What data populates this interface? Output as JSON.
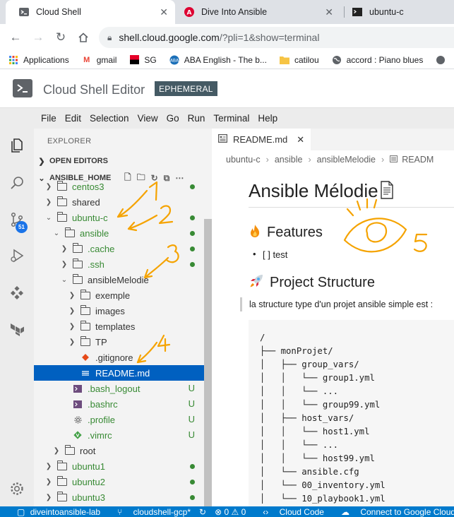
{
  "browser": {
    "tabs": [
      {
        "title": "Cloud Shell",
        "active": true
      },
      {
        "title": "Dive Into Ansible",
        "active": false
      },
      {
        "title": "ubuntu-c",
        "active": false
      }
    ],
    "url_host": "shell.cloud.google.com",
    "url_path": "/?pli=1&show=terminal",
    "bookmarks": [
      "Applications",
      "gmail",
      "SG",
      "ABA English - The b...",
      "catilou",
      "accord : Piano blues"
    ]
  },
  "cloudshell": {
    "title": "Cloud Shell Editor",
    "badge": "EPHEMERAL"
  },
  "menu": [
    "File",
    "Edit",
    "Selection",
    "View",
    "Go",
    "Run",
    "Terminal",
    "Help"
  ],
  "activity": {
    "scm_badge": "51"
  },
  "explorer": {
    "header": "EXPLORER",
    "open_editors": "OPEN EDITORS",
    "workspace": "ANSIBLE_HOME",
    "items": [
      {
        "label": "centos3",
        "indent": 1,
        "kind": "folder",
        "open": false,
        "green": true,
        "mark": "dot"
      },
      {
        "label": "shared",
        "indent": 1,
        "kind": "folder",
        "open": false,
        "green": false,
        "mark": ""
      },
      {
        "label": "ubuntu-c",
        "indent": 1,
        "kind": "folder",
        "open": true,
        "green": true,
        "mark": "dot"
      },
      {
        "label": "ansible",
        "indent": 2,
        "kind": "folder",
        "open": true,
        "green": true,
        "mark": "dot"
      },
      {
        "label": ".cache",
        "indent": 3,
        "kind": "folder",
        "open": false,
        "green": true,
        "mark": "dot"
      },
      {
        "label": ".ssh",
        "indent": 3,
        "kind": "folder",
        "open": false,
        "green": true,
        "mark": "dot"
      },
      {
        "label": "ansibleMelodie",
        "indent": 3,
        "kind": "folder",
        "open": true,
        "green": false,
        "mark": ""
      },
      {
        "label": "exemple",
        "indent": 4,
        "kind": "folder",
        "open": false,
        "green": false,
        "mark": ""
      },
      {
        "label": "images",
        "indent": 4,
        "kind": "folder",
        "open": false,
        "green": false,
        "mark": ""
      },
      {
        "label": "templates",
        "indent": 4,
        "kind": "folder",
        "open": false,
        "green": false,
        "mark": ""
      },
      {
        "label": "TP",
        "indent": 4,
        "kind": "folder",
        "open": false,
        "green": false,
        "mark": ""
      },
      {
        "label": ".gitignore",
        "indent": 4,
        "kind": "gitignore",
        "open": false,
        "green": false,
        "mark": ""
      },
      {
        "label": "README.md",
        "indent": 4,
        "kind": "md",
        "open": false,
        "green": false,
        "mark": "",
        "selected": true
      },
      {
        "label": ".bash_logout",
        "indent": 3,
        "kind": "shell",
        "open": false,
        "green": true,
        "mark": "U"
      },
      {
        "label": ".bashrc",
        "indent": 3,
        "kind": "shell",
        "open": false,
        "green": true,
        "mark": "U"
      },
      {
        "label": ".profile",
        "indent": 3,
        "kind": "gear",
        "open": false,
        "green": true,
        "mark": "U"
      },
      {
        "label": ".vimrc",
        "indent": 3,
        "kind": "vim",
        "open": false,
        "green": true,
        "mark": "U"
      },
      {
        "label": "root",
        "indent": 2,
        "kind": "folder",
        "open": false,
        "green": false,
        "mark": ""
      },
      {
        "label": "ubuntu1",
        "indent": 1,
        "kind": "folder",
        "open": false,
        "green": true,
        "mark": "dot"
      },
      {
        "label": "ubuntu2",
        "indent": 1,
        "kind": "folder",
        "open": false,
        "green": true,
        "mark": "dot"
      },
      {
        "label": "ubuntu3",
        "indent": 1,
        "kind": "folder",
        "open": false,
        "green": true,
        "mark": "dot"
      }
    ]
  },
  "editor": {
    "tab_label": "README.md",
    "breadcrumb": [
      "ubuntu-c",
      "ansible",
      "ansibleMelodie",
      "READM"
    ],
    "h1": "Ansible Mélodie",
    "h2_features": "Features",
    "features_item": "[ ] test",
    "h2_structure": "Project Structure",
    "intro": "la structure type d'un projet ansible simple est :",
    "code_lines": [
      "/",
      "├── monProjet/",
      "│   ├── group_vars/",
      "│   │   └── group1.yml",
      "│   │   └── ...",
      "│   │   └── group99.yml",
      "│   ├── host_vars/",
      "│   │   └── host1.yml",
      "│   │   └── ...",
      "│   │   └── host99.yml",
      "│   └── ansible.cfg",
      "│   └── 00_inventory.yml",
      "│   └── 10_playbook1.yml"
    ]
  },
  "statusbar": {
    "remote": "diveintoansible-lab",
    "branch": "cloudshell-gcp*",
    "problems": "⊗ 0 ⚠ 0",
    "cloud_code": "Cloud Code",
    "connect": "Connect to Google Cloud"
  },
  "annotations": [
    "1",
    "2",
    "3",
    "4",
    "5"
  ],
  "colors": {
    "accent": "#007acc",
    "selection": "#0060c0",
    "git_green": "#388a34",
    "annotation": "#f5a300"
  }
}
